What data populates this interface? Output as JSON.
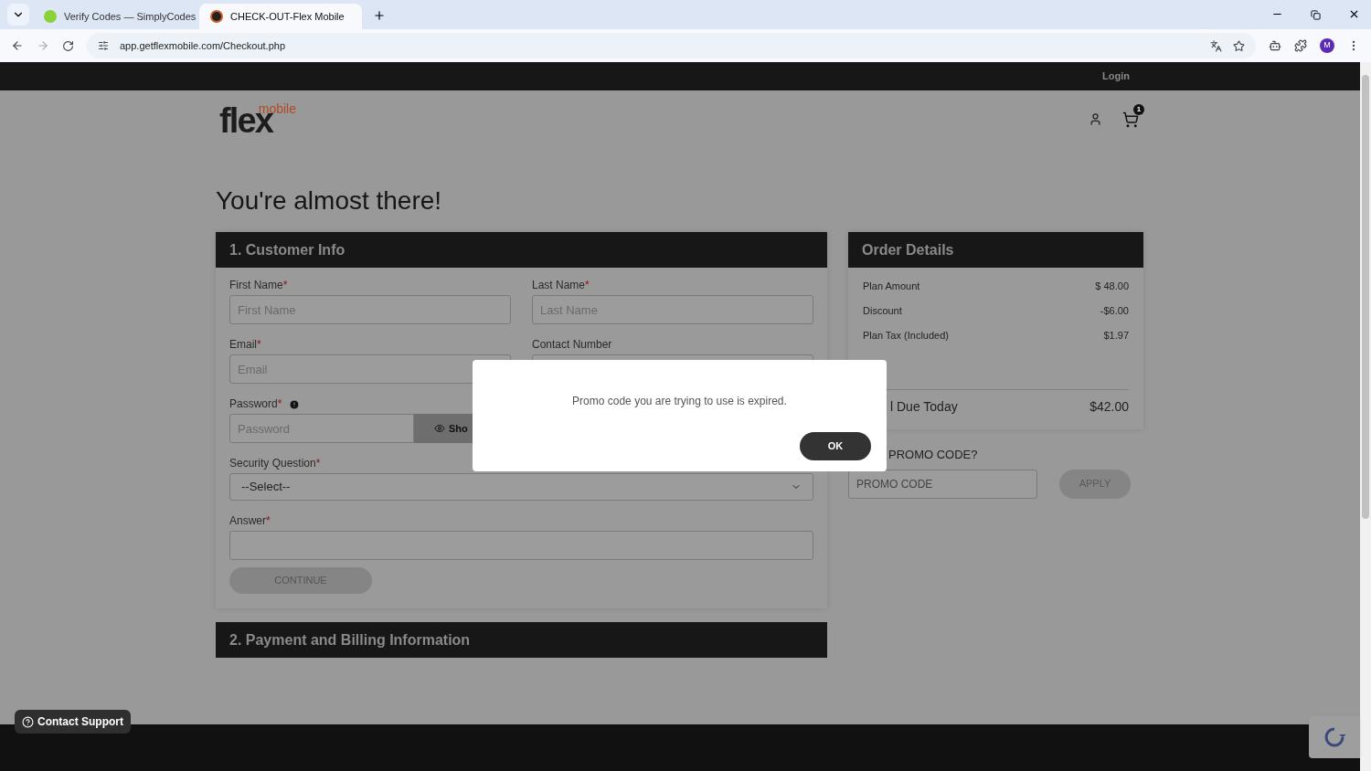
{
  "browser": {
    "tabs": [
      {
        "title": "Verify Codes — SimplyCodes",
        "selected": false
      },
      {
        "title": "CHECK-OUT-Flex Mobile",
        "selected": true
      }
    ],
    "url": "app.getflexmobile.com/Checkout.php",
    "profile": "M"
  },
  "topbar": {
    "login": "Login"
  },
  "header": {
    "logo": {
      "word": "flex",
      "sub": "mobile"
    },
    "cart_count": "1"
  },
  "heading": "You're almost there!",
  "customer_info": {
    "title": "1. Customer Info",
    "rows": [
      {
        "fields": [
          {
            "kind": "text",
            "label": "First Name",
            "required_mark": "*",
            "placeholder": "First Name"
          },
          {
            "kind": "text",
            "label": "Last Name",
            "required_mark": "*",
            "placeholder": "Last Name"
          }
        ]
      },
      {
        "fields": [
          {
            "kind": "text",
            "label": "Email",
            "required_mark": "*",
            "placeholder": "Email"
          },
          {
            "kind": "text",
            "label": "Contact Number"
          }
        ]
      },
      {
        "fields": [
          {
            "kind": "password",
            "label": "Password",
            "required_mark": "*",
            "placeholder": "Password",
            "show_button": "Sho"
          }
        ]
      },
      {
        "fields": [
          {
            "kind": "select",
            "label": "Security Question",
            "required_mark": "*",
            "value": "--Select--"
          }
        ]
      },
      {
        "fields": [
          {
            "kind": "text",
            "label": "Answer",
            "required_mark": "*"
          }
        ]
      }
    ],
    "continue": {
      "label": "CONTINUE",
      "disabled": true
    }
  },
  "order_details": {
    "title": "Order Details",
    "rows": [
      {
        "label": "Plan Amount",
        "value": "$ 48.00"
      },
      {
        "label": "Discount",
        "value": "-$6.00"
      },
      {
        "label": "Plan Tax (Included)",
        "value": "$1.97"
      }
    ],
    "total": {
      "label": "l Due Today",
      "value": "$42.00"
    },
    "promo": {
      "label": "PROMO CODE?",
      "placeholder": "PROMO CODE",
      "button": "APPLY",
      "disabled": true
    }
  },
  "payment_title": "2. Payment and Billing Information",
  "contact_support": "Contact Support",
  "modal": {
    "message": "Promo code you are trying to use is expired.",
    "button": "OK"
  }
}
